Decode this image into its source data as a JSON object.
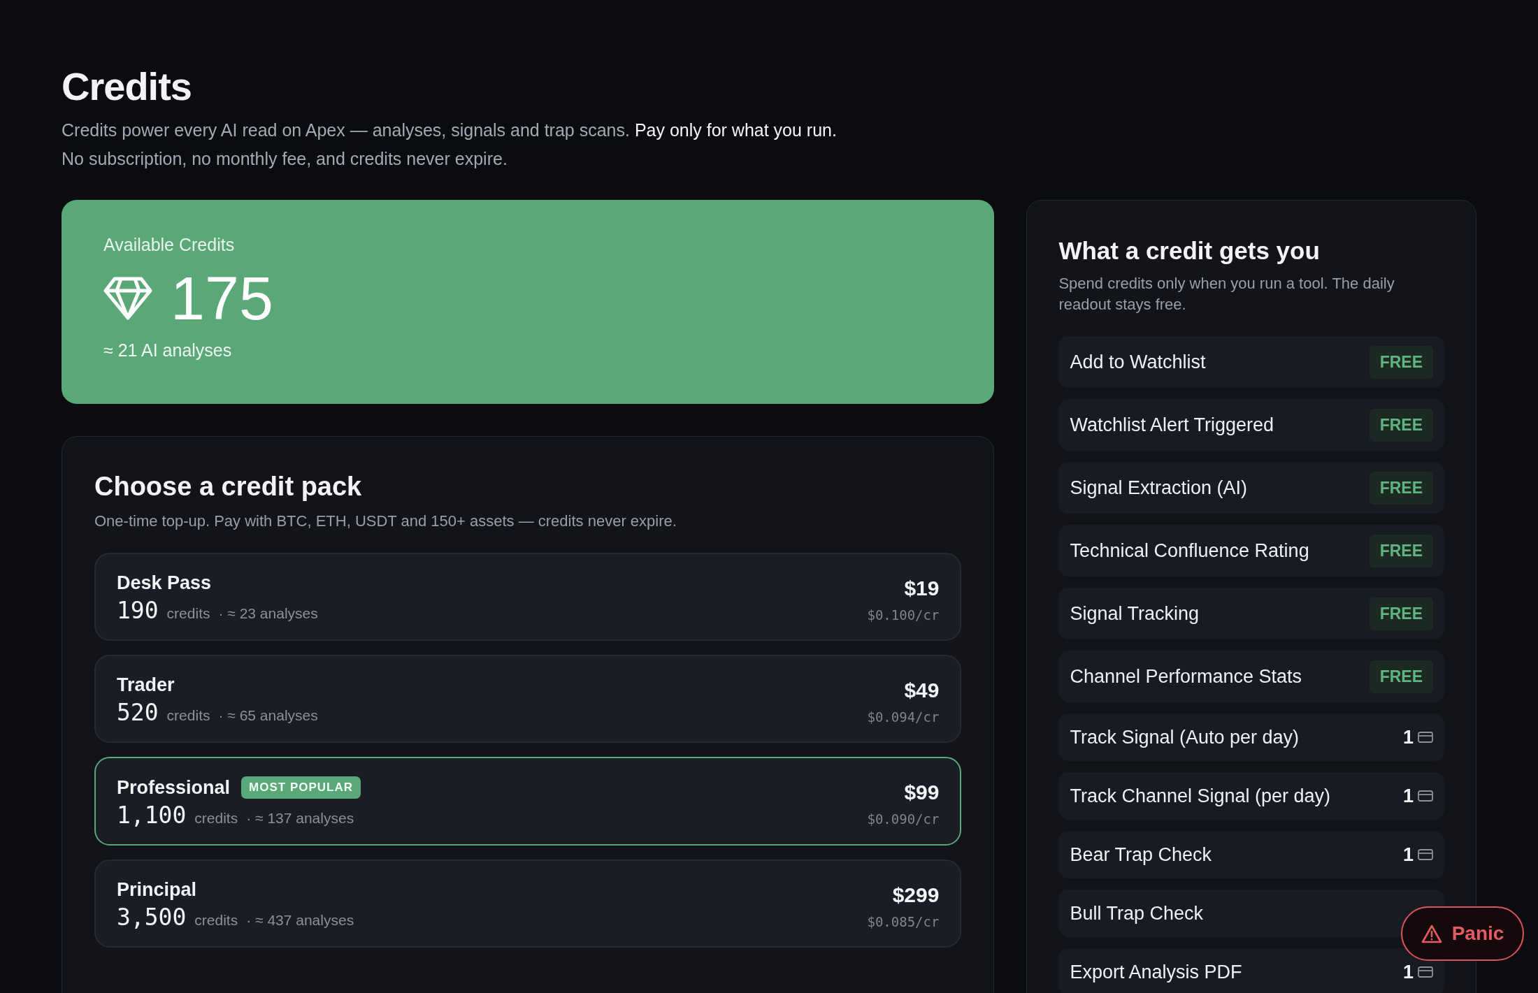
{
  "header": {
    "title": "Credits",
    "intro": "Credits power every AI read on Apex — analyses, signals and trap scans. **Pay only for what you run.**",
    "intro_line2": "No subscription, no monthly fee, and credits never expire."
  },
  "balance": {
    "label": "Available Credits",
    "amount": "175",
    "equivalent": "≈ 21 AI analyses"
  },
  "packs": {
    "title": "Choose a credit pack",
    "subtitle": "One-time top-up. Pay with BTC, ETH, USDT and 150+ assets — credits never expire.",
    "items": [
      {
        "name": "Desk Pass",
        "credits": "190",
        "unit": "credits",
        "analyses": "· ≈ 23 analyses",
        "price": "$19",
        "per_credit": "$0.100/cr",
        "featured": false
      },
      {
        "name": "Trader",
        "credits": "520",
        "unit": "credits",
        "analyses": "· ≈ 65 analyses",
        "price": "$49",
        "per_credit": "$0.094/cr",
        "featured": false
      },
      {
        "name": "Professional",
        "badge": "MOST POPULAR",
        "credits": "1,100",
        "unit": "credits",
        "analyses": "· ≈ 137 analyses",
        "price": "$99",
        "per_credit": "$0.090/cr",
        "featured": true
      },
      {
        "name": "Principal",
        "credits": "3,500",
        "unit": "credits",
        "analyses": "· ≈ 437 analyses",
        "price": "$299",
        "per_credit": "$0.085/cr",
        "featured": false
      }
    ]
  },
  "costs": {
    "title": "What a credit gets you",
    "subtitle": "Spend credits only when you run a tool. The daily readout stays free.",
    "items": [
      {
        "label": "Add to Watchlist",
        "kind": "free",
        "price": "FREE"
      },
      {
        "label": "Watchlist Alert Triggered",
        "kind": "free",
        "price": "FREE"
      },
      {
        "label": "Signal Extraction (AI)",
        "kind": "free",
        "price": "FREE"
      },
      {
        "label": "Technical Confluence Rating",
        "kind": "free",
        "price": "FREE"
      },
      {
        "label": "Signal Tracking",
        "kind": "free",
        "price": "FREE"
      },
      {
        "label": "Channel Performance Stats",
        "kind": "free",
        "price": "FREE"
      },
      {
        "label": "Track Signal (Auto per day)",
        "kind": "cost",
        "price": "1"
      },
      {
        "label": "Track Channel Signal (per day)",
        "kind": "cost",
        "price": "1"
      },
      {
        "label": "Bear Trap Check",
        "kind": "cost",
        "price": "1"
      },
      {
        "label": "Bull Trap Check",
        "kind": "hidden"
      },
      {
        "label": "Export Analysis PDF",
        "kind": "cost",
        "price": "1"
      }
    ]
  },
  "panic_button": {
    "label": "Panic"
  }
}
